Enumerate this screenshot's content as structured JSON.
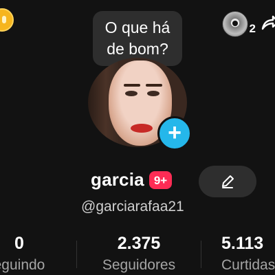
{
  "header": {
    "coin_icon": "coin-icon",
    "friends_count": "2",
    "share_icon": "share-arrow-icon"
  },
  "profile": {
    "bubble_text_line1": "O que há",
    "bubble_text_line2": "de bom?",
    "name": "garcia",
    "notification_badge": "9+",
    "handle": "@garciarafaa21",
    "add_icon": "+"
  },
  "stats": {
    "following": {
      "value": "0",
      "label": "eguindo"
    },
    "followers": {
      "value": "2.375",
      "label": "Seguidores"
    },
    "likes": {
      "value": "5.113",
      "label": "Curtidas"
    }
  },
  "colors": {
    "background": "#121212",
    "accent_blue": "#25b7ea",
    "badge_red": "#fe2c55",
    "coin_gold": "#f6b51e"
  }
}
